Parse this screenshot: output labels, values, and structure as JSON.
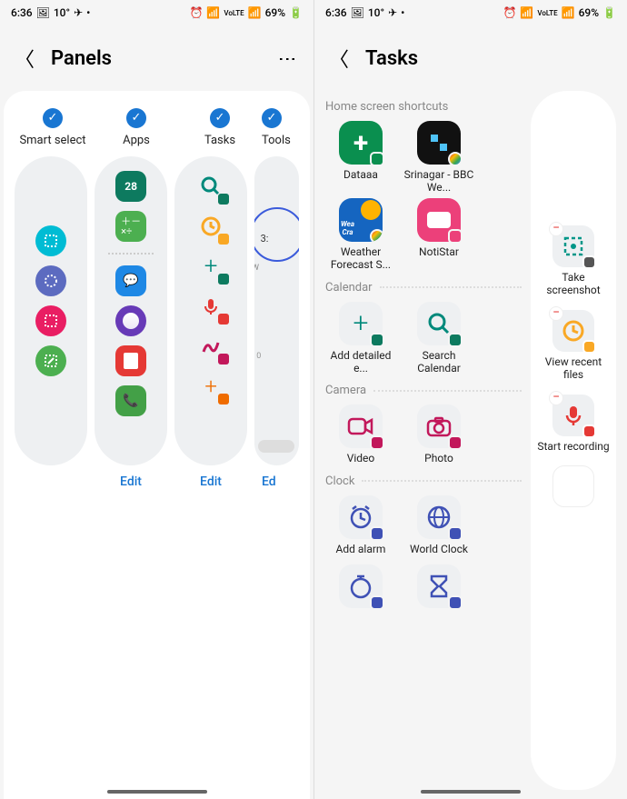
{
  "status": {
    "time": "6:36",
    "temp": "10°",
    "battery": "69%",
    "net": "VoLTE"
  },
  "left": {
    "title": "Panels",
    "tabs": [
      "Smart select",
      "Apps",
      "Tasks",
      "Tools"
    ],
    "edit": "Edit",
    "editCut": "Ed"
  },
  "right": {
    "title": "Tasks",
    "sections": {
      "home": "Home screen shortcuts",
      "calendar": "Calendar",
      "camera": "Camera",
      "clock": "Clock"
    },
    "apps": {
      "dataaa": "Dataaa",
      "srinagar": "Srinagar - BBC We...",
      "weather": "Weather Forecast S...",
      "notistar": "NotiStar",
      "addEvent": "Add detailed e...",
      "searchCal": "Search Calendar",
      "video": "Video",
      "photo": "Photo",
      "addAlarm": "Add alarm",
      "worldClock": "World Clock"
    },
    "side": {
      "screenshot": "Take screenshot",
      "recent": "View recent files",
      "record": "Start recording"
    }
  }
}
